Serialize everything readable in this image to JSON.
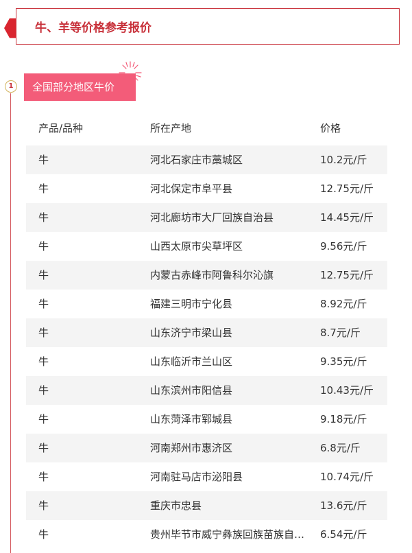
{
  "header": {
    "title": "牛、羊等价格参考报价"
  },
  "section": {
    "number": "1",
    "tag": "全国部分地区牛价"
  },
  "table": {
    "columns": [
      "产品/品种",
      "所在产地",
      "价格"
    ],
    "rows": [
      {
        "product": "牛",
        "origin": "河北石家庄市藁城区",
        "price": "10.2元/斤"
      },
      {
        "product": "牛",
        "origin": "河北保定市阜平县",
        "price": "12.75元/斤"
      },
      {
        "product": "牛",
        "origin": "河北廊坊市大厂回族自治县",
        "price": "14.45元/斤"
      },
      {
        "product": "牛",
        "origin": "山西太原市尖草坪区",
        "price": "9.56元/斤"
      },
      {
        "product": "牛",
        "origin": "内蒙古赤峰市阿鲁科尔沁旗",
        "price": "12.75元/斤"
      },
      {
        "product": "牛",
        "origin": "福建三明市宁化县",
        "price": "8.92元/斤"
      },
      {
        "product": "牛",
        "origin": "山东济宁市梁山县",
        "price": "8.7元/斤"
      },
      {
        "product": "牛",
        "origin": "山东临沂市兰山区",
        "price": "9.35元/斤"
      },
      {
        "product": "牛",
        "origin": "山东滨州市阳信县",
        "price": "10.43元/斤"
      },
      {
        "product": "牛",
        "origin": "山东菏泽市郓城县",
        "price": "9.18元/斤"
      },
      {
        "product": "牛",
        "origin": "河南郑州市惠济区",
        "price": "6.8元/斤"
      },
      {
        "product": "牛",
        "origin": "河南驻马店市泌阳县",
        "price": "10.74元/斤"
      },
      {
        "product": "牛",
        "origin": "重庆市忠县",
        "price": "13.6元/斤"
      },
      {
        "product": "牛",
        "origin": "贵州毕节市威宁彝族回族苗族自…",
        "price": "6.54元/斤"
      }
    ]
  },
  "colors": {
    "accent": "#c8313a",
    "tag_background": "#f35c79",
    "row_shade": "#f4f4f4"
  }
}
